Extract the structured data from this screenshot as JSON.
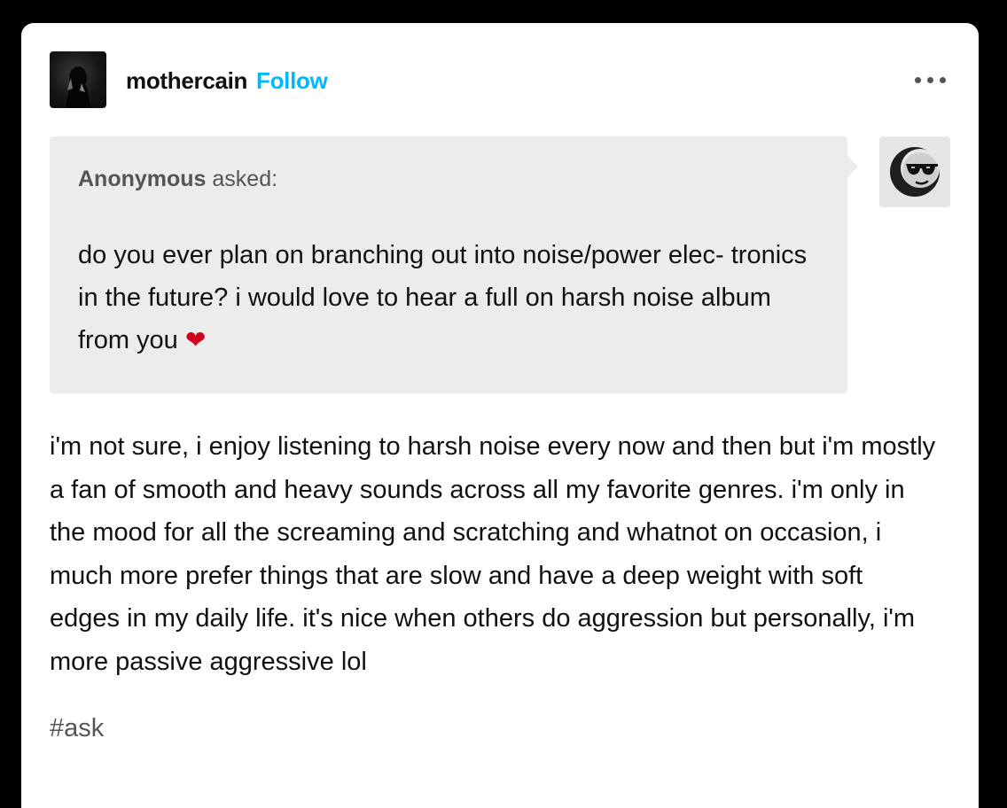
{
  "post": {
    "username": "mothercain",
    "follow_label": "Follow",
    "more_icon": "ellipsis-icon",
    "ask": {
      "asker_name": "Anonymous",
      "asked_label": "asked:",
      "question_text": "do you ever plan on branching out into noise/power elec- tronics in the future? i would love to hear a full on harsh noise album from you",
      "question_emoji": "❤",
      "asker_avatar_icon": "anonymous-sunglasses-avatar"
    },
    "answer_text": "i'm not sure, i enjoy listening to harsh noise every now and then but i'm mostly a fan of smooth and heavy sounds across all my favorite genres. i'm only in the mood for all the screaming and scratching and whatnot on occasion, i much more prefer things that are slow and have a deep weight with soft edges in my daily life. it's nice when others do aggression but personally, i'm more passive aggressive lol",
    "tag": "#ask"
  },
  "colors": {
    "follow": "#00b8ff",
    "bubble": "#ececec",
    "heart": "#d0021b"
  }
}
